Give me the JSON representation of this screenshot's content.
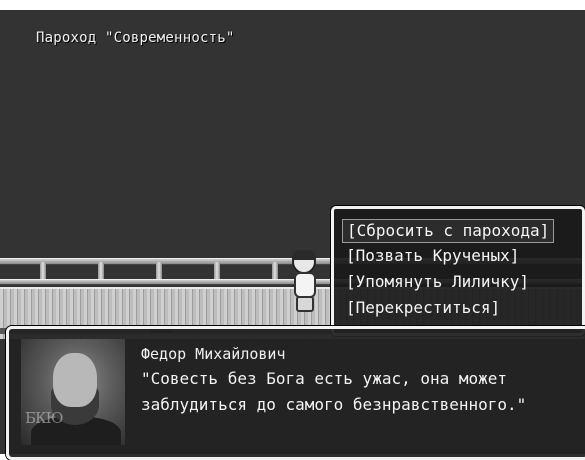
{
  "scene": {
    "location": "Пароход \"Современность\""
  },
  "choice_menu": {
    "selected_index": 0,
    "options": [
      "[Сбросить с парохода]",
      "[Позвать Крученых]",
      "[Упомянуть Лиличку]",
      "[Перекреститься]"
    ]
  },
  "dialogue": {
    "speaker": "Федор Михайлович",
    "lines": [
      "\"Совесть без Бога есть ужас, она может",
      "заблудиться до самого безнравственного.\""
    ],
    "portrait_watermark": "БКЮ"
  },
  "colors": {
    "background": "#333333",
    "window_border": "#f2f2f2",
    "text": "#f4f4f4"
  }
}
